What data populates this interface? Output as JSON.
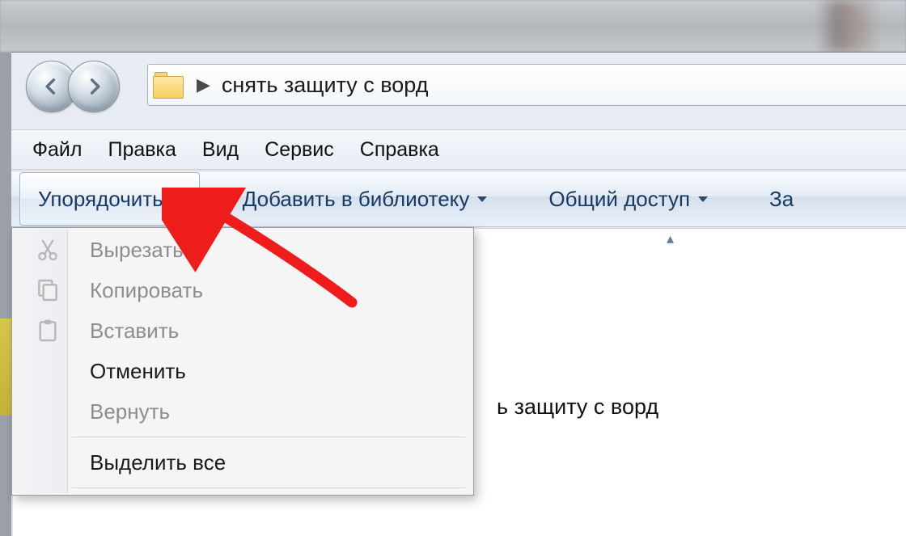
{
  "address": {
    "folder_name": "снять защиту с ворд"
  },
  "menubar": {
    "file": "Файл",
    "edit": "Правка",
    "view": "Вид",
    "tools": "Сервис",
    "help": "Справка"
  },
  "cmdbar": {
    "organize": "Упорядочить",
    "add_to_library": "Добавить в библиотеку",
    "share": "Общий доступ",
    "burn_partial": "За"
  },
  "content": {
    "visible_item_text": "ь защиту с ворд"
  },
  "organize_menu": {
    "cut": "Вырезать",
    "copy": "Копировать",
    "paste": "Вставить",
    "undo": "Отменить",
    "redo": "Вернуть",
    "select_all": "Выделить все"
  }
}
